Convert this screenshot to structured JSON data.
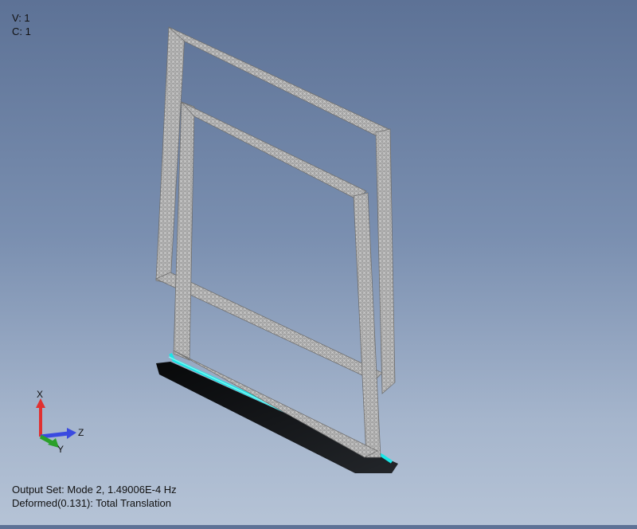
{
  "view_info": {
    "view": "V: 1",
    "config": "C: 1"
  },
  "output_info": {
    "output_set": "Output Set: Mode 2, 1.49006E-4 Hz",
    "deformed": "Deformed(0.131): Total Translation"
  },
  "triad": {
    "x_label": "X",
    "y_label": "Y",
    "z_label": "Z"
  },
  "colors": {
    "mesh_fill": "#a9a9a9",
    "mesh_dark": "#8c8c8c",
    "constraint": "#19e6e6",
    "shadow": "#000000",
    "axis_x": "#e03030",
    "axis_y": "#2aa02a",
    "axis_z": "#3a4ae0"
  }
}
